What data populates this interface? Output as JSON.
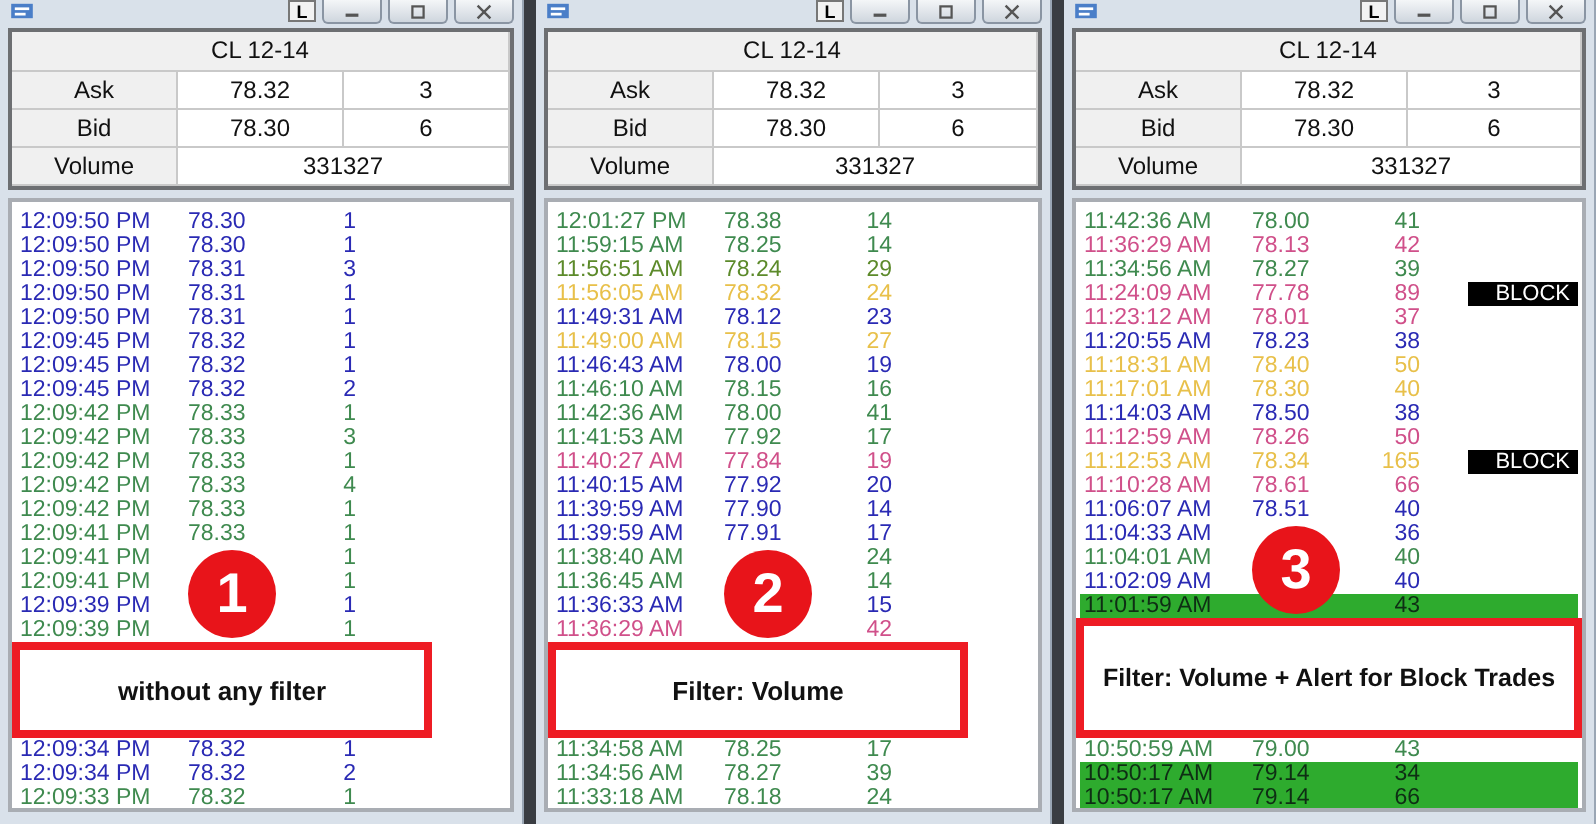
{
  "windows": [
    {
      "button": "L",
      "quote": {
        "symbol": "CL 12-14",
        "ask": {
          "label": "Ask",
          "price": "78.32",
          "size": "3"
        },
        "bid": {
          "label": "Bid",
          "price": "78.30",
          "size": "6"
        },
        "volume": {
          "label": "Volume",
          "value": "331327"
        }
      },
      "rows": [
        {
          "kind": "trade",
          "time": "12:09:50 PM",
          "price": "78.30",
          "size": "1",
          "color": "#2a2ab4",
          "highlighted": false
        },
        {
          "kind": "trade",
          "time": "12:09:50 PM",
          "price": "78.30",
          "size": "1",
          "color": "#2a2ab4",
          "highlighted": false
        },
        {
          "kind": "trade",
          "time": "12:09:50 PM",
          "price": "78.31",
          "size": "3",
          "color": "#2a2ab4",
          "highlighted": false
        },
        {
          "kind": "trade",
          "time": "12:09:50 PM",
          "price": "78.31",
          "size": "1",
          "color": "#2a2ab4",
          "highlighted": false
        },
        {
          "kind": "trade",
          "time": "12:09:50 PM",
          "price": "78.31",
          "size": "1",
          "color": "#2a2ab4",
          "highlighted": false
        },
        {
          "kind": "trade",
          "time": "12:09:45 PM",
          "price": "78.32",
          "size": "1",
          "color": "#2a2ab4",
          "highlighted": false
        },
        {
          "kind": "trade",
          "time": "12:09:45 PM",
          "price": "78.32",
          "size": "1",
          "color": "#2a2ab4",
          "highlighted": false
        },
        {
          "kind": "trade",
          "time": "12:09:45 PM",
          "price": "78.32",
          "size": "2",
          "color": "#2a2ab4",
          "highlighted": false
        },
        {
          "kind": "trade",
          "time": "12:09:42 PM",
          "price": "78.33",
          "size": "1",
          "color": "#3f8a4f",
          "highlighted": false
        },
        {
          "kind": "trade",
          "time": "12:09:42 PM",
          "price": "78.33",
          "size": "3",
          "color": "#3f8a4f",
          "highlighted": false
        },
        {
          "kind": "trade",
          "time": "12:09:42 PM",
          "price": "78.33",
          "size": "1",
          "color": "#3f8a4f",
          "highlighted": false
        },
        {
          "kind": "trade",
          "time": "12:09:42 PM",
          "price": "78.33",
          "size": "4",
          "color": "#3f8a4f",
          "highlighted": false
        },
        {
          "kind": "trade",
          "time": "12:09:42 PM",
          "price": "78.33",
          "size": "1",
          "color": "#3f8a4f",
          "highlighted": false
        },
        {
          "kind": "trade",
          "time": "12:09:41 PM",
          "price": "78.33",
          "size": "1",
          "color": "#3f8a4f",
          "highlighted": false
        },
        {
          "kind": "trade",
          "time": "12:09:41 PM",
          "size": "1",
          "color": "#3f8a4f",
          "highlighted": false
        },
        {
          "kind": "trade",
          "time": "12:09:41 PM",
          "size": "1",
          "color": "#3f8a4f",
          "highlighted": false
        },
        {
          "kind": "trade",
          "time": "12:09:39 PM",
          "size": "1",
          "color": "#2a2ab4",
          "highlighted": false
        },
        {
          "kind": "trade",
          "time": "12:09:39 PM",
          "size": "1",
          "color": "#3f8a4f",
          "highlighted": false
        },
        {
          "kind": "covered"
        },
        {
          "kind": "covered"
        },
        {
          "kind": "covered"
        },
        {
          "kind": "covered"
        },
        {
          "kind": "trade",
          "time": "12:09:34 PM",
          "price": "78.32",
          "size": "1",
          "color": "#2a2ab4",
          "highlighted": false
        },
        {
          "kind": "trade",
          "time": "12:09:34 PM",
          "price": "78.32",
          "size": "2",
          "color": "#2a2ab4",
          "highlighted": false
        },
        {
          "kind": "trade",
          "time": "12:09:33 PM",
          "price": "78.32",
          "size": "1",
          "color": "#3f8a4f",
          "highlighted": false
        }
      ],
      "callout": {
        "number": "1",
        "label": "without any filter"
      }
    },
    {
      "button": "L",
      "quote": {
        "symbol": "CL 12-14",
        "ask": {
          "label": "Ask",
          "price": "78.32",
          "size": "3"
        },
        "bid": {
          "label": "Bid",
          "price": "78.30",
          "size": "6"
        },
        "volume": {
          "label": "Volume",
          "value": "331327"
        }
      },
      "rows": [
        {
          "kind": "trade",
          "time": "12:01:27 PM",
          "price": "78.38",
          "size": "14",
          "color": "#3f8a4f",
          "highlighted": false
        },
        {
          "kind": "trade",
          "time": "11:59:15 AM",
          "price": "78.25",
          "size": "14",
          "color": "#3f8a4f",
          "highlighted": false
        },
        {
          "kind": "trade",
          "time": "11:56:51 AM",
          "price": "78.24",
          "size": "29",
          "color": "#5c8a2a",
          "highlighted": false
        },
        {
          "kind": "trade",
          "time": "11:56:05 AM",
          "price": "78.32",
          "size": "24",
          "color": "#e8c04a",
          "highlighted": false
        },
        {
          "kind": "trade",
          "time": "11:49:31 AM",
          "price": "78.12",
          "size": "23",
          "color": "#2a2ab4",
          "highlighted": false
        },
        {
          "kind": "trade",
          "time": "11:49:00 AM",
          "price": "78.15",
          "size": "27",
          "color": "#e8c04a",
          "highlighted": false
        },
        {
          "kind": "trade",
          "time": "11:46:43 AM",
          "price": "78.00",
          "size": "19",
          "color": "#2a2ab4",
          "highlighted": false
        },
        {
          "kind": "trade",
          "time": "11:46:10 AM",
          "price": "78.15",
          "size": "16",
          "color": "#3f8a4f",
          "highlighted": false
        },
        {
          "kind": "trade",
          "time": "11:42:36 AM",
          "price": "78.00",
          "size": "41",
          "color": "#3f8a4f",
          "highlighted": false
        },
        {
          "kind": "trade",
          "time": "11:41:53 AM",
          "price": "77.92",
          "size": "17",
          "color": "#3f8a4f",
          "highlighted": false
        },
        {
          "kind": "trade",
          "time": "11:40:27 AM",
          "price": "77.84",
          "size": "19",
          "color": "#d0508a",
          "highlighted": false
        },
        {
          "kind": "trade",
          "time": "11:40:15 AM",
          "price": "77.92",
          "size": "20",
          "color": "#2a2ab4",
          "highlighted": false
        },
        {
          "kind": "trade",
          "time": "11:39:59 AM",
          "price": "77.90",
          "size": "14",
          "color": "#2a2ab4",
          "highlighted": false
        },
        {
          "kind": "trade",
          "time": "11:39:59 AM",
          "price": "77.91",
          "size": "17",
          "color": "#2a2ab4",
          "highlighted": false
        },
        {
          "kind": "trade",
          "time": "11:38:40 AM",
          "size": "24",
          "color": "#3f8a4f",
          "highlighted": false
        },
        {
          "kind": "trade",
          "time": "11:36:45 AM",
          "size": "14",
          "color": "#3f8a4f",
          "highlighted": false
        },
        {
          "kind": "trade",
          "time": "11:36:33 AM",
          "size": "15",
          "color": "#2a2ab4",
          "highlighted": false
        },
        {
          "kind": "trade",
          "time": "11:36:29 AM",
          "size": "42",
          "color": "#d0508a",
          "highlighted": false
        },
        {
          "kind": "covered"
        },
        {
          "kind": "covered"
        },
        {
          "kind": "covered"
        },
        {
          "kind": "covered"
        },
        {
          "kind": "trade",
          "time": "11:34:58 AM",
          "price": "78.25",
          "size": "17",
          "color": "#3f8a4f",
          "highlighted": false
        },
        {
          "kind": "trade",
          "time": "11:34:56 AM",
          "price": "78.27",
          "size": "39",
          "color": "#3f8a4f",
          "highlighted": false
        },
        {
          "kind": "trade",
          "time": "11:33:18 AM",
          "price": "78.18",
          "size": "24",
          "color": "#3f8a4f",
          "highlighted": false
        }
      ],
      "callout": {
        "number": "2",
        "label": "Filter: Volume"
      }
    },
    {
      "button": "L",
      "quote": {
        "symbol": "CL 12-14",
        "ask": {
          "label": "Ask",
          "price": "78.32",
          "size": "3"
        },
        "bid": {
          "label": "Bid",
          "price": "78.30",
          "size": "6"
        },
        "volume": {
          "label": "Volume",
          "value": "331327"
        }
      },
      "rows": [
        {
          "kind": "trade",
          "time": "11:42:36 AM",
          "price": "78.00",
          "size": "41",
          "color": "#3f8a4f",
          "highlighted": false
        },
        {
          "kind": "trade",
          "time": "11:36:29 AM",
          "price": "78.13",
          "size": "42",
          "color": "#d0508a",
          "highlighted": false
        },
        {
          "kind": "trade",
          "time": "11:34:56 AM",
          "price": "78.27",
          "size": "39",
          "color": "#3f8a4f",
          "highlighted": false
        },
        {
          "kind": "trade",
          "time": "11:24:09 AM",
          "price": "77.78",
          "size": "89",
          "color": "#d0508a",
          "highlighted": false,
          "alert": "BLOCK"
        },
        {
          "kind": "trade",
          "time": "11:23:12 AM",
          "price": "78.01",
          "size": "37",
          "color": "#d0508a",
          "highlighted": false
        },
        {
          "kind": "trade",
          "time": "11:20:55 AM",
          "price": "78.23",
          "size": "38",
          "color": "#2a2ab4",
          "highlighted": false
        },
        {
          "kind": "trade",
          "time": "11:18:31 AM",
          "price": "78.40",
          "size": "50",
          "color": "#e8c04a",
          "highlighted": false
        },
        {
          "kind": "trade",
          "time": "11:17:01 AM",
          "price": "78.30",
          "size": "40",
          "color": "#e8c04a",
          "highlighted": false
        },
        {
          "kind": "trade",
          "time": "11:14:03 AM",
          "price": "78.50",
          "size": "38",
          "color": "#2a2ab4",
          "highlighted": false
        },
        {
          "kind": "trade",
          "time": "11:12:59 AM",
          "price": "78.26",
          "size": "50",
          "color": "#d0508a",
          "highlighted": false
        },
        {
          "kind": "trade",
          "time": "11:12:53 AM",
          "price": "78.34",
          "size": "165",
          "color": "#e8c04a",
          "highlighted": false,
          "alert": "BLOCK"
        },
        {
          "kind": "trade",
          "time": "11:10:28 AM",
          "price": "78.61",
          "size": "66",
          "color": "#d0508a",
          "highlighted": false
        },
        {
          "kind": "trade",
          "time": "11:06:07 AM",
          "price": "78.51",
          "size": "40",
          "color": "#2a2ab4",
          "highlighted": false
        },
        {
          "kind": "trade",
          "time": "11:04:33 AM",
          "size": "36",
          "color": "#2a2ab4",
          "highlighted": false
        },
        {
          "kind": "trade",
          "time": "11:04:01 AM",
          "size": "40",
          "color": "#3f8a4f",
          "highlighted": false
        },
        {
          "kind": "trade",
          "time": "11:02:09 AM",
          "size": "40",
          "color": "#2a2ab4",
          "highlighted": false
        },
        {
          "kind": "trade",
          "time": "11:01:59 AM",
          "size": "43",
          "highlighted": true
        },
        {
          "kind": "covered"
        },
        {
          "kind": "covered"
        },
        {
          "kind": "covered"
        },
        {
          "kind": "covered"
        },
        {
          "kind": "covered"
        },
        {
          "kind": "trade",
          "time": "10:50:59 AM",
          "price": "79.00",
          "size": "43",
          "color": "#3f8a4f",
          "highlighted": false
        },
        {
          "kind": "trade",
          "time": "10:50:17 AM",
          "price": "79.14",
          "size": "34",
          "highlighted": true
        },
        {
          "kind": "trade",
          "time": "10:50:17 AM",
          "price": "79.14",
          "size": "66",
          "highlighted": true
        }
      ],
      "callout": {
        "number": "3",
        "label": "Filter: Volume + Alert for Block Trades"
      }
    }
  ]
}
